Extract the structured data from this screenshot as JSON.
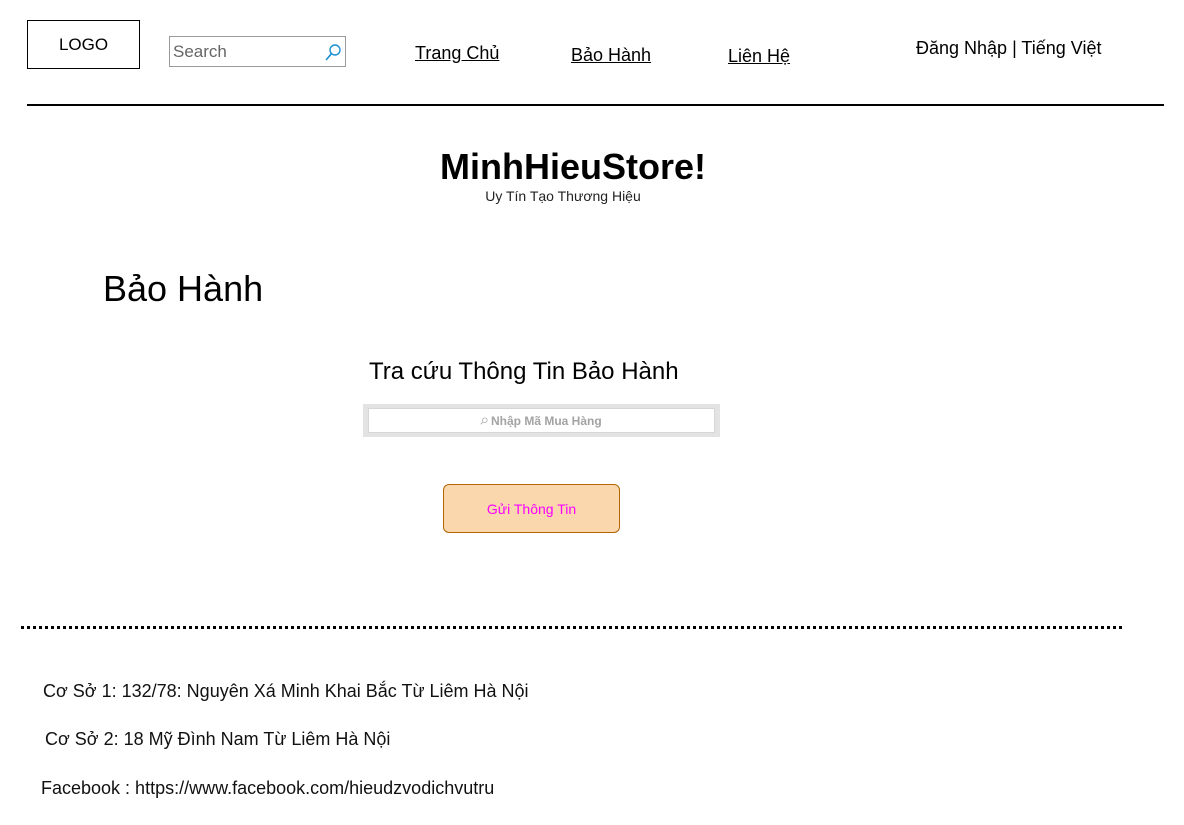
{
  "header": {
    "logo": "LOGO",
    "search_placeholder": "Search",
    "nav": [
      {
        "label": "Trang Chủ"
      },
      {
        "label": "Bảo Hành"
      },
      {
        "label": "Liên Hệ"
      }
    ],
    "account_links": "Đăng Nhập | Tiếng Việt"
  },
  "brand": {
    "title": "MinhHieuStore!",
    "tagline": "Uy Tín Tạo Thương Hiệu"
  },
  "main": {
    "page_title": "Bảo Hành",
    "lookup_title": "Tra cứu Thông Tin Bảo Hành",
    "code_placeholder": "Nhập Mã Mua Hàng",
    "submit_label": "Gửi Thông Tin"
  },
  "footer": {
    "lines": [
      "Cơ Sở 1: 132/78: Nguyên Xá Minh Khai Bắc Từ Liêm Hà Nội",
      "Cơ Sở 2: 18 Mỹ Đình Nam Từ Liêm Hà Nội",
      "Facebook : https://www.facebook.com/hieudzvodichvutru"
    ]
  },
  "colors": {
    "button_fill": "#fad7ad",
    "button_border": "#b46504",
    "button_text": "#ff00ff",
    "search_icon": "#1a8fd0"
  },
  "icons": [
    "search-icon"
  ]
}
